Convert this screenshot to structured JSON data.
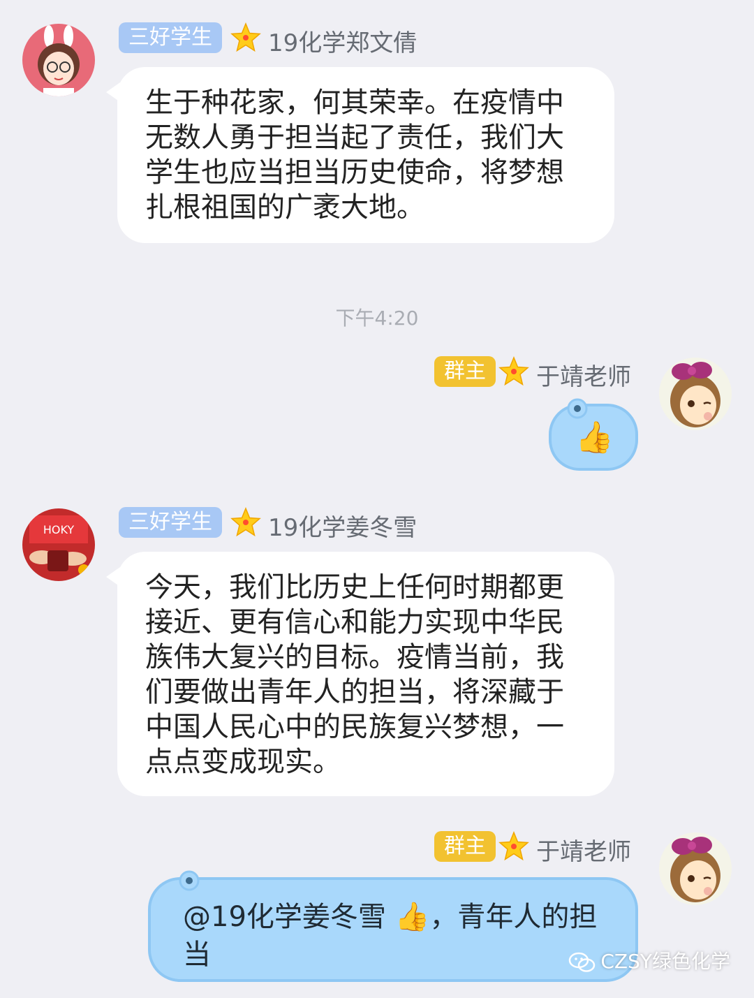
{
  "messages": [
    {
      "badge": "三好学生",
      "nickname": "19化学郑文倩",
      "text": "生于种花家，何其荣幸。在疫情中无数人勇于担当起了责任，我们大学生也应当担当历史使命，将梦想扎根祖国的广袤大地。"
    },
    {
      "badge": "群主",
      "nickname": "于靖老师",
      "icon": "thumbs-up-icon",
      "emoji": "👍"
    },
    {
      "badge": "三好学生",
      "nickname": "19化学姜冬雪",
      "text": "今天，我们比历史上任何时期都更接近、更有信心和能力实现中华民族伟大复兴的目标。疫情当前，我们要做出青年人的担当，将深藏于中国人民心中的民族复兴梦想，一点点变成现实。"
    },
    {
      "badge": "群主",
      "nickname": "于靖老师",
      "mention": "@19化学姜冬雪",
      "emoji": "👍",
      "text": "，青年人的担当"
    }
  ],
  "timestamp": "下午4:20",
  "watermark": "CZSY绿色化学",
  "colors": {
    "background": "#efeff4",
    "student_badge": "#a8c8f5",
    "owner_badge": "#f2c230",
    "teacher_bubble": "#a9d8fb"
  }
}
